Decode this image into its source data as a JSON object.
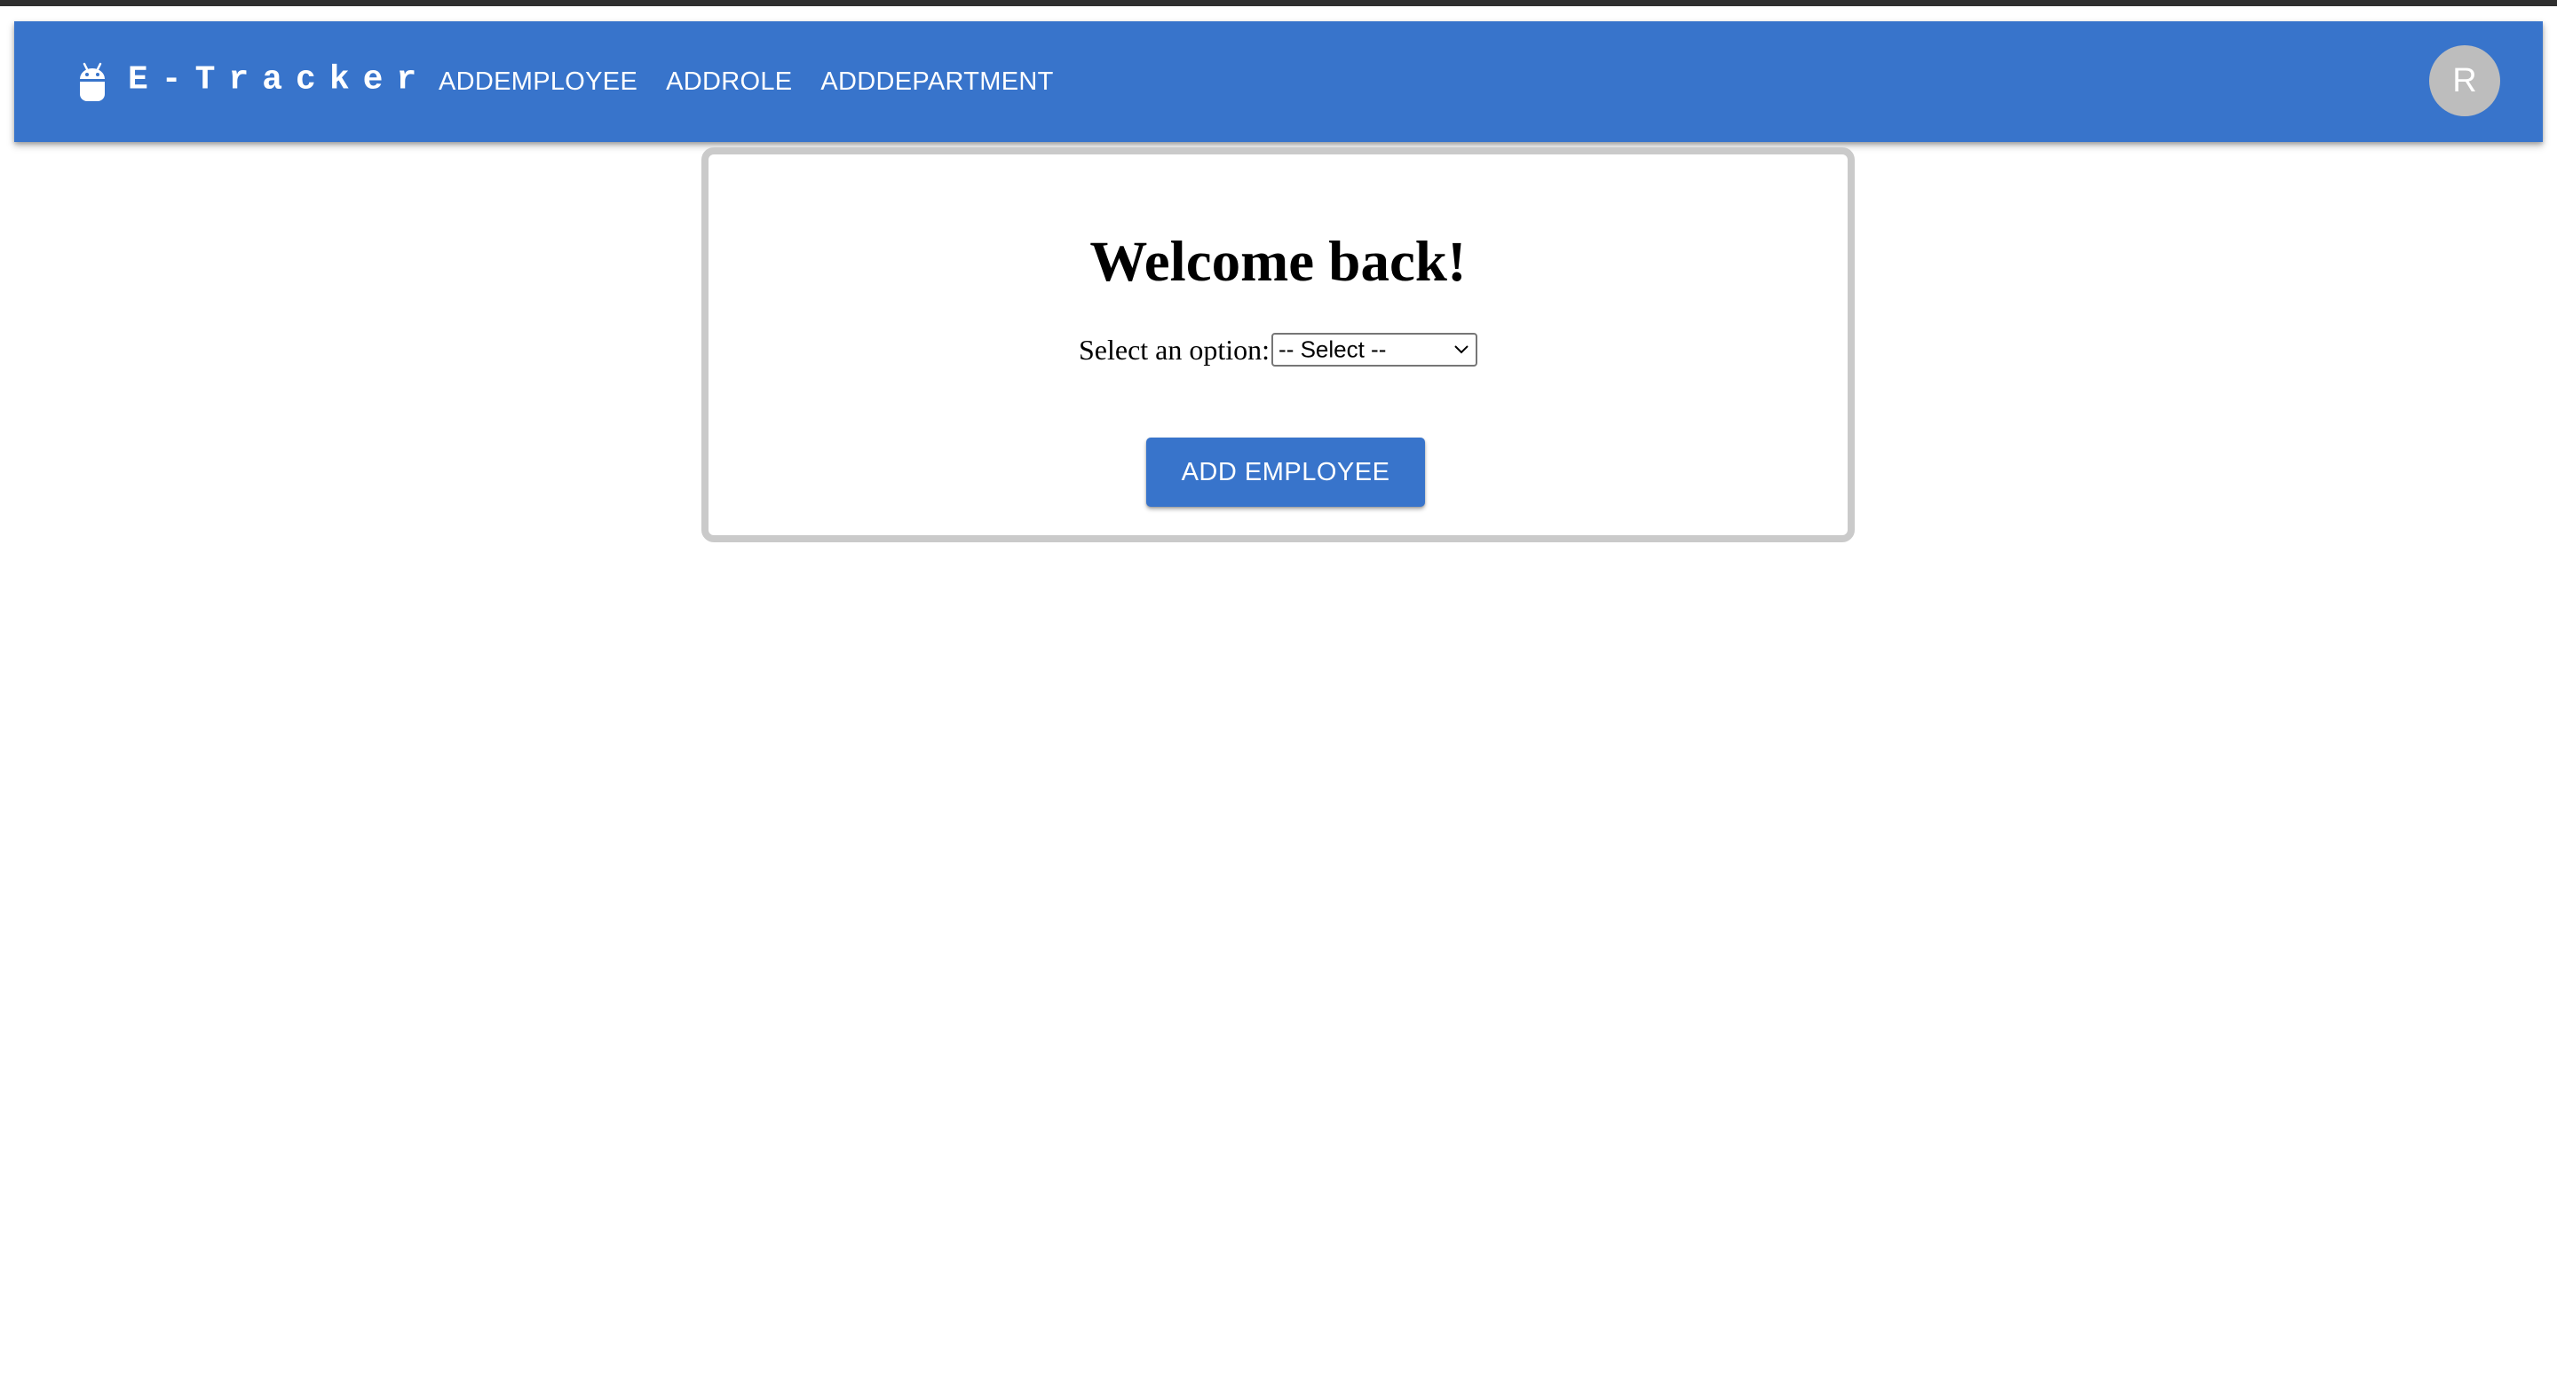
{
  "appbar": {
    "brand": "E-Tracker",
    "logo_icon": "android-robot-icon",
    "nav": [
      {
        "label": "ADDEMPLOYEE"
      },
      {
        "label": "ADDROLE"
      },
      {
        "label": "ADDDEPARTMENT"
      }
    ],
    "avatar_initial": "R"
  },
  "main": {
    "heading": "Welcome back!",
    "select_label": "Select an option:",
    "select_value": "-- Select --",
    "select_icon": "chevron-down-icon",
    "action_button": "ADD EMPLOYEE"
  },
  "colors": {
    "primary": "#3874cb",
    "avatar_bg": "#bdbdbd",
    "card_border": "#cacaca"
  }
}
